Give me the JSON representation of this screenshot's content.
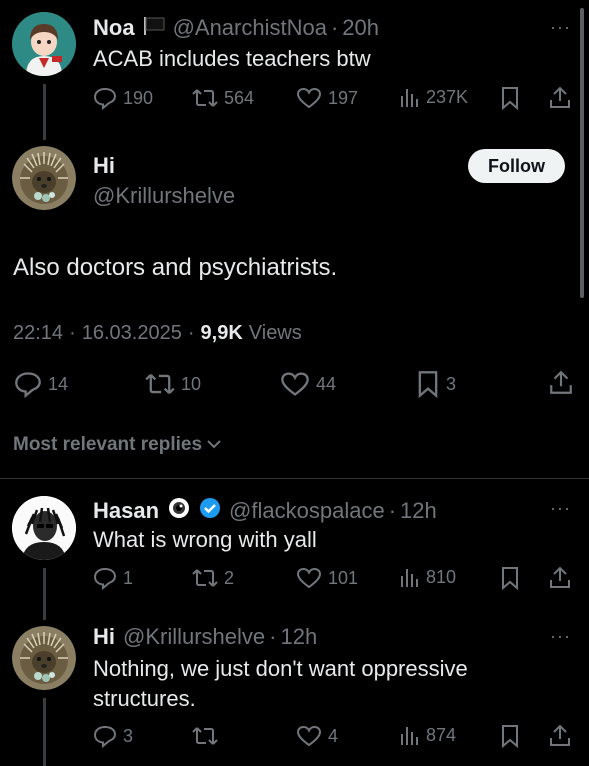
{
  "tweet1": {
    "name": "Noa",
    "handle": "@AnarchistNoa",
    "sep": "·",
    "time": "20h",
    "text": "ACAB includes teachers btw",
    "replies": "190",
    "retweets": "564",
    "likes": "197",
    "views": "237K"
  },
  "main": {
    "name": "Hi",
    "handle": "@Krillurshelve",
    "follow_label": "Follow",
    "text": "Also doctors and psychiatrists.",
    "time": "22:14",
    "sep1": "·",
    "date": "16.03.2025",
    "sep2": "·",
    "views_count": "9,9K",
    "views_label": "Views",
    "replies": "14",
    "retweets": "10",
    "likes": "44",
    "bookmarks": "3"
  },
  "replies_sort_label": "Most relevant replies",
  "reply1": {
    "name": "Hasan",
    "handle": "@flackospalace",
    "sep": "·",
    "time": "12h",
    "text": "What is wrong with yall",
    "replies": "1",
    "retweets": "2",
    "likes": "101",
    "views": "810"
  },
  "reply2": {
    "name": "Hi",
    "handle": "@Krillurshelve",
    "sep": "·",
    "time": "12h",
    "text_line1": "Nothing, we just don't want oppressive",
    "text_line2": "structures.",
    "replies": "3",
    "likes": "4",
    "views": "874"
  },
  "more_glyph": "···",
  "colors": {
    "background": "#000000",
    "text": "#e7e9ea",
    "muted": "#71767b",
    "verified": "#1d9bf0",
    "follow_bg": "#eff3f4"
  }
}
